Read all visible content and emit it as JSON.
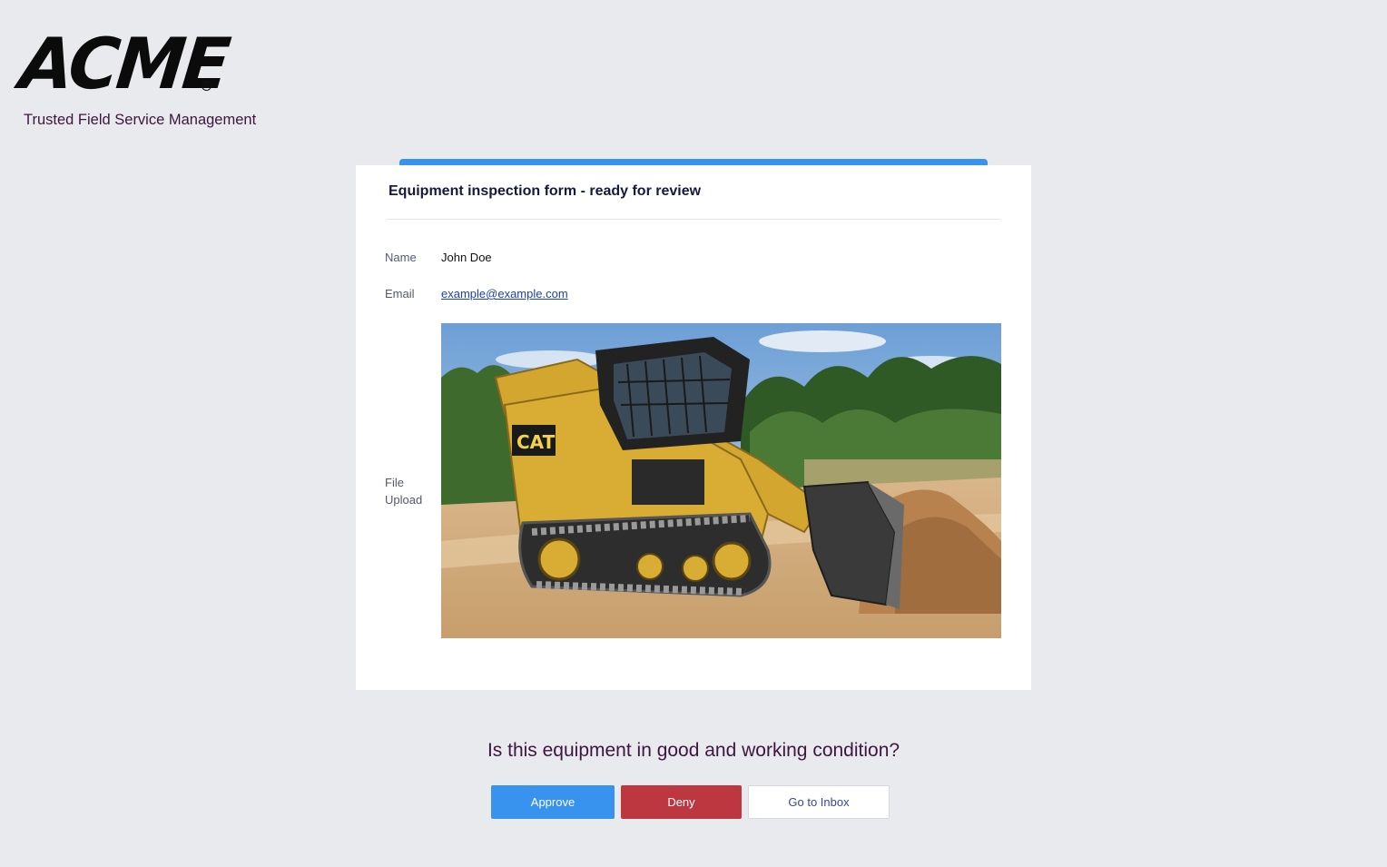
{
  "brand": {
    "logo_text": "ACME",
    "registered_mark": "R",
    "tagline": "Trusted Field Service Management"
  },
  "card": {
    "title": "Equipment inspection form - ready for review",
    "fields": {
      "name_label": "Name",
      "name_value": "John Doe",
      "email_label": "Email",
      "email_value": "example@example.com",
      "upload_label": "File Upload"
    },
    "photo_icon": "tracked-skid-steer-loader-photo"
  },
  "question": "Is this equipment in good and working condition?",
  "actions": {
    "approve_label": "Approve",
    "deny_label": "Deny",
    "inbox_label": "Go to Inbox"
  },
  "colors": {
    "accent": "#3793ee",
    "deny": "#bc3740",
    "heading": "#3d1640",
    "background": "#e9eaee"
  }
}
